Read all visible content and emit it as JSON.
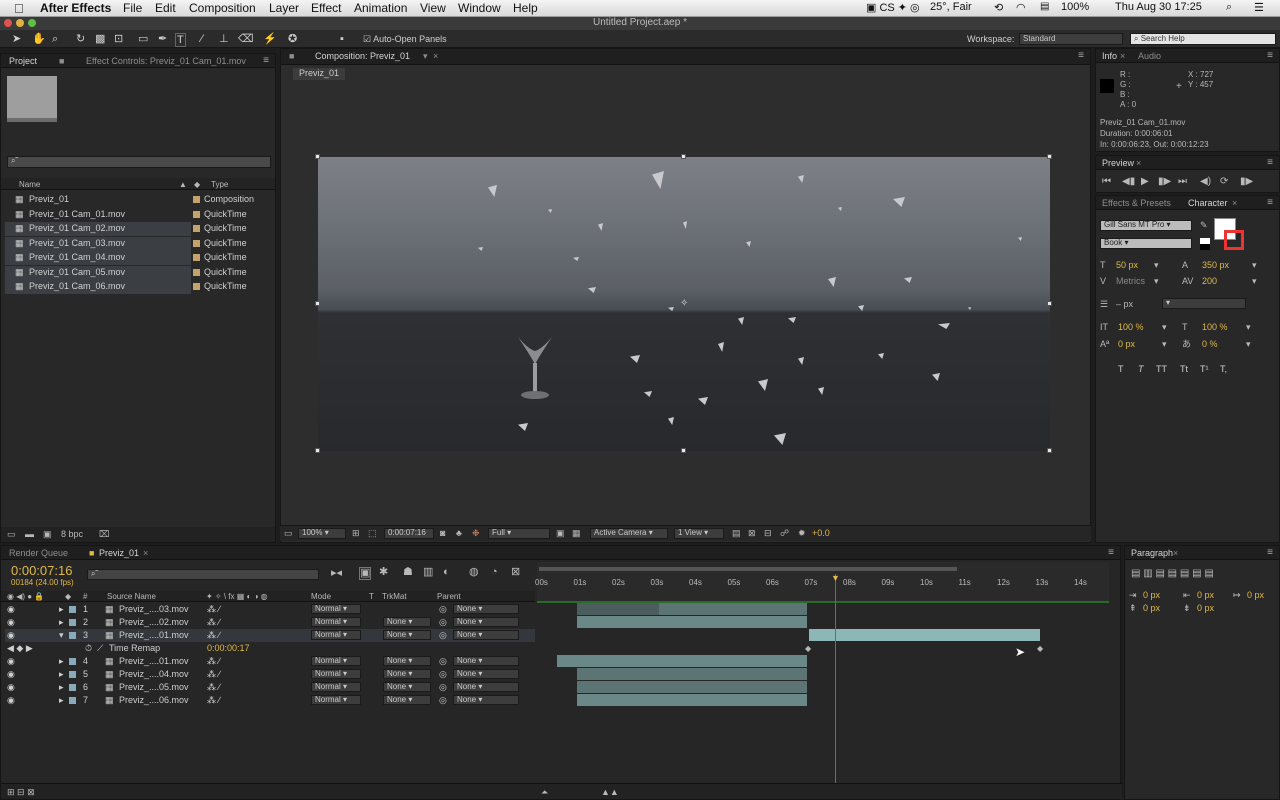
{
  "menubar": {
    "app": "After Effects",
    "items": [
      "File",
      "Edit",
      "Composition",
      "Layer",
      "Effect",
      "Animation",
      "View",
      "Window",
      "Help"
    ],
    "status": {
      "weather": "25°, Fair",
      "battery": "100%",
      "clock": "Thu Aug 30  17:25"
    }
  },
  "window": {
    "title": "Untitled Project.aep *"
  },
  "toolbar": {
    "auto_open": "Auto-Open Panels",
    "workspace_label": "Workspace:",
    "workspace_value": "Standard",
    "search_placeholder": "Search Help"
  },
  "project": {
    "tab": "Project",
    "tab2": "Effect Controls: Previz_01 Cam_01.mov",
    "col_name": "Name",
    "col_type": "Type",
    "bpc": "8 bpc",
    "items": [
      {
        "name": "Previz_01",
        "type": "Composition",
        "sel": false,
        "color": "#c4a36a"
      },
      {
        "name": "Previz_01 Cam_01.mov",
        "type": "QuickTime",
        "sel": false,
        "color": "#c4a36a"
      },
      {
        "name": "Previz_01 Cam_02.mov",
        "type": "QuickTime",
        "sel": true,
        "color": "#c4a36a"
      },
      {
        "name": "Previz_01 Cam_03.mov",
        "type": "QuickTime",
        "sel": true,
        "color": "#c4a36a"
      },
      {
        "name": "Previz_01 Cam_04.mov",
        "type": "QuickTime",
        "sel": true,
        "color": "#c4a36a"
      },
      {
        "name": "Previz_01 Cam_05.mov",
        "type": "QuickTime",
        "sel": true,
        "color": "#c4a36a"
      },
      {
        "name": "Previz_01 Cam_06.mov",
        "type": "QuickTime",
        "sel": true,
        "color": "#c4a36a"
      }
    ]
  },
  "composition": {
    "tab": "Composition: Previz_01",
    "subtab": "Previz_01",
    "zoom": "100%",
    "timecode": "0:00:07:16",
    "resolution": "Full",
    "camera": "Active Camera",
    "views": "1 View",
    "exposure": "+0.0"
  },
  "info": {
    "tab": "Info",
    "tab2": "Audio",
    "r": "R :",
    "g": "G :",
    "b": "B :",
    "a": "A : 0",
    "x": "X : 727",
    "y": "Y : 457",
    "file": "Previz_01 Cam_01.mov",
    "duration": "Duration: 0:00:06:01",
    "inout": "In: 0:00:06:23, Out: 0:00:12:23"
  },
  "preview": {
    "tab": "Preview"
  },
  "character": {
    "tab": "Effects & Presets",
    "tab2": "Character",
    "font": "Gill Sans MT Pro",
    "style": "Book",
    "size": "50 px",
    "leading": "350 px",
    "kerning": "Metrics",
    "tracking": "200",
    "stroke": "– px",
    "vscale": "100 %",
    "hscale": "100 %",
    "baseline": "0 px",
    "tsume": "0 %",
    "formats": [
      "T",
      "T",
      "TT",
      "Tt",
      "T¹",
      "T,"
    ]
  },
  "paragraph": {
    "tab": "Paragraph",
    "values": [
      "0 px",
      "0 px",
      "0 px",
      "0 px",
      "0 px"
    ]
  },
  "timeline": {
    "tab": "Render Queue",
    "tab2": "Previz_01",
    "timecode": "0:00:07:16",
    "fps": "00184 (24.00 fps)",
    "headers": {
      "num": "#",
      "source": "Source Name",
      "mode": "Mode",
      "t": "T",
      "trkmat": "TrkMat",
      "parent": "Parent"
    },
    "ruler": [
      "00s",
      "01s",
      "02s",
      "03s",
      "04s",
      "05s",
      "06s",
      "07s",
      "08s",
      "09s",
      "10s",
      "11s",
      "12s",
      "13s",
      "14s"
    ],
    "layers": [
      {
        "num": "1",
        "name": "Previz_....03.mov",
        "mode": "Normal",
        "trk": "",
        "parent": "None"
      },
      {
        "num": "2",
        "name": "Previz_....02.mov",
        "mode": "Normal",
        "trk": "None",
        "parent": "None"
      },
      {
        "num": "3",
        "name": "Previz_....01.mov",
        "mode": "Normal",
        "trk": "None",
        "parent": "None"
      },
      {
        "num": "4",
        "name": "Previz_....01.mov",
        "mode": "Normal",
        "trk": "None",
        "parent": "None"
      },
      {
        "num": "5",
        "name": "Previz_....04.mov",
        "mode": "Normal",
        "trk": "None",
        "parent": "None"
      },
      {
        "num": "6",
        "name": "Previz_....05.mov",
        "mode": "Normal",
        "trk": "None",
        "parent": "None"
      },
      {
        "num": "7",
        "name": "Previz_....06.mov",
        "mode": "Normal",
        "trk": "None",
        "parent": "None"
      }
    ],
    "time_remap": "Time Remap",
    "time_remap_value": "0:00:00:17"
  }
}
